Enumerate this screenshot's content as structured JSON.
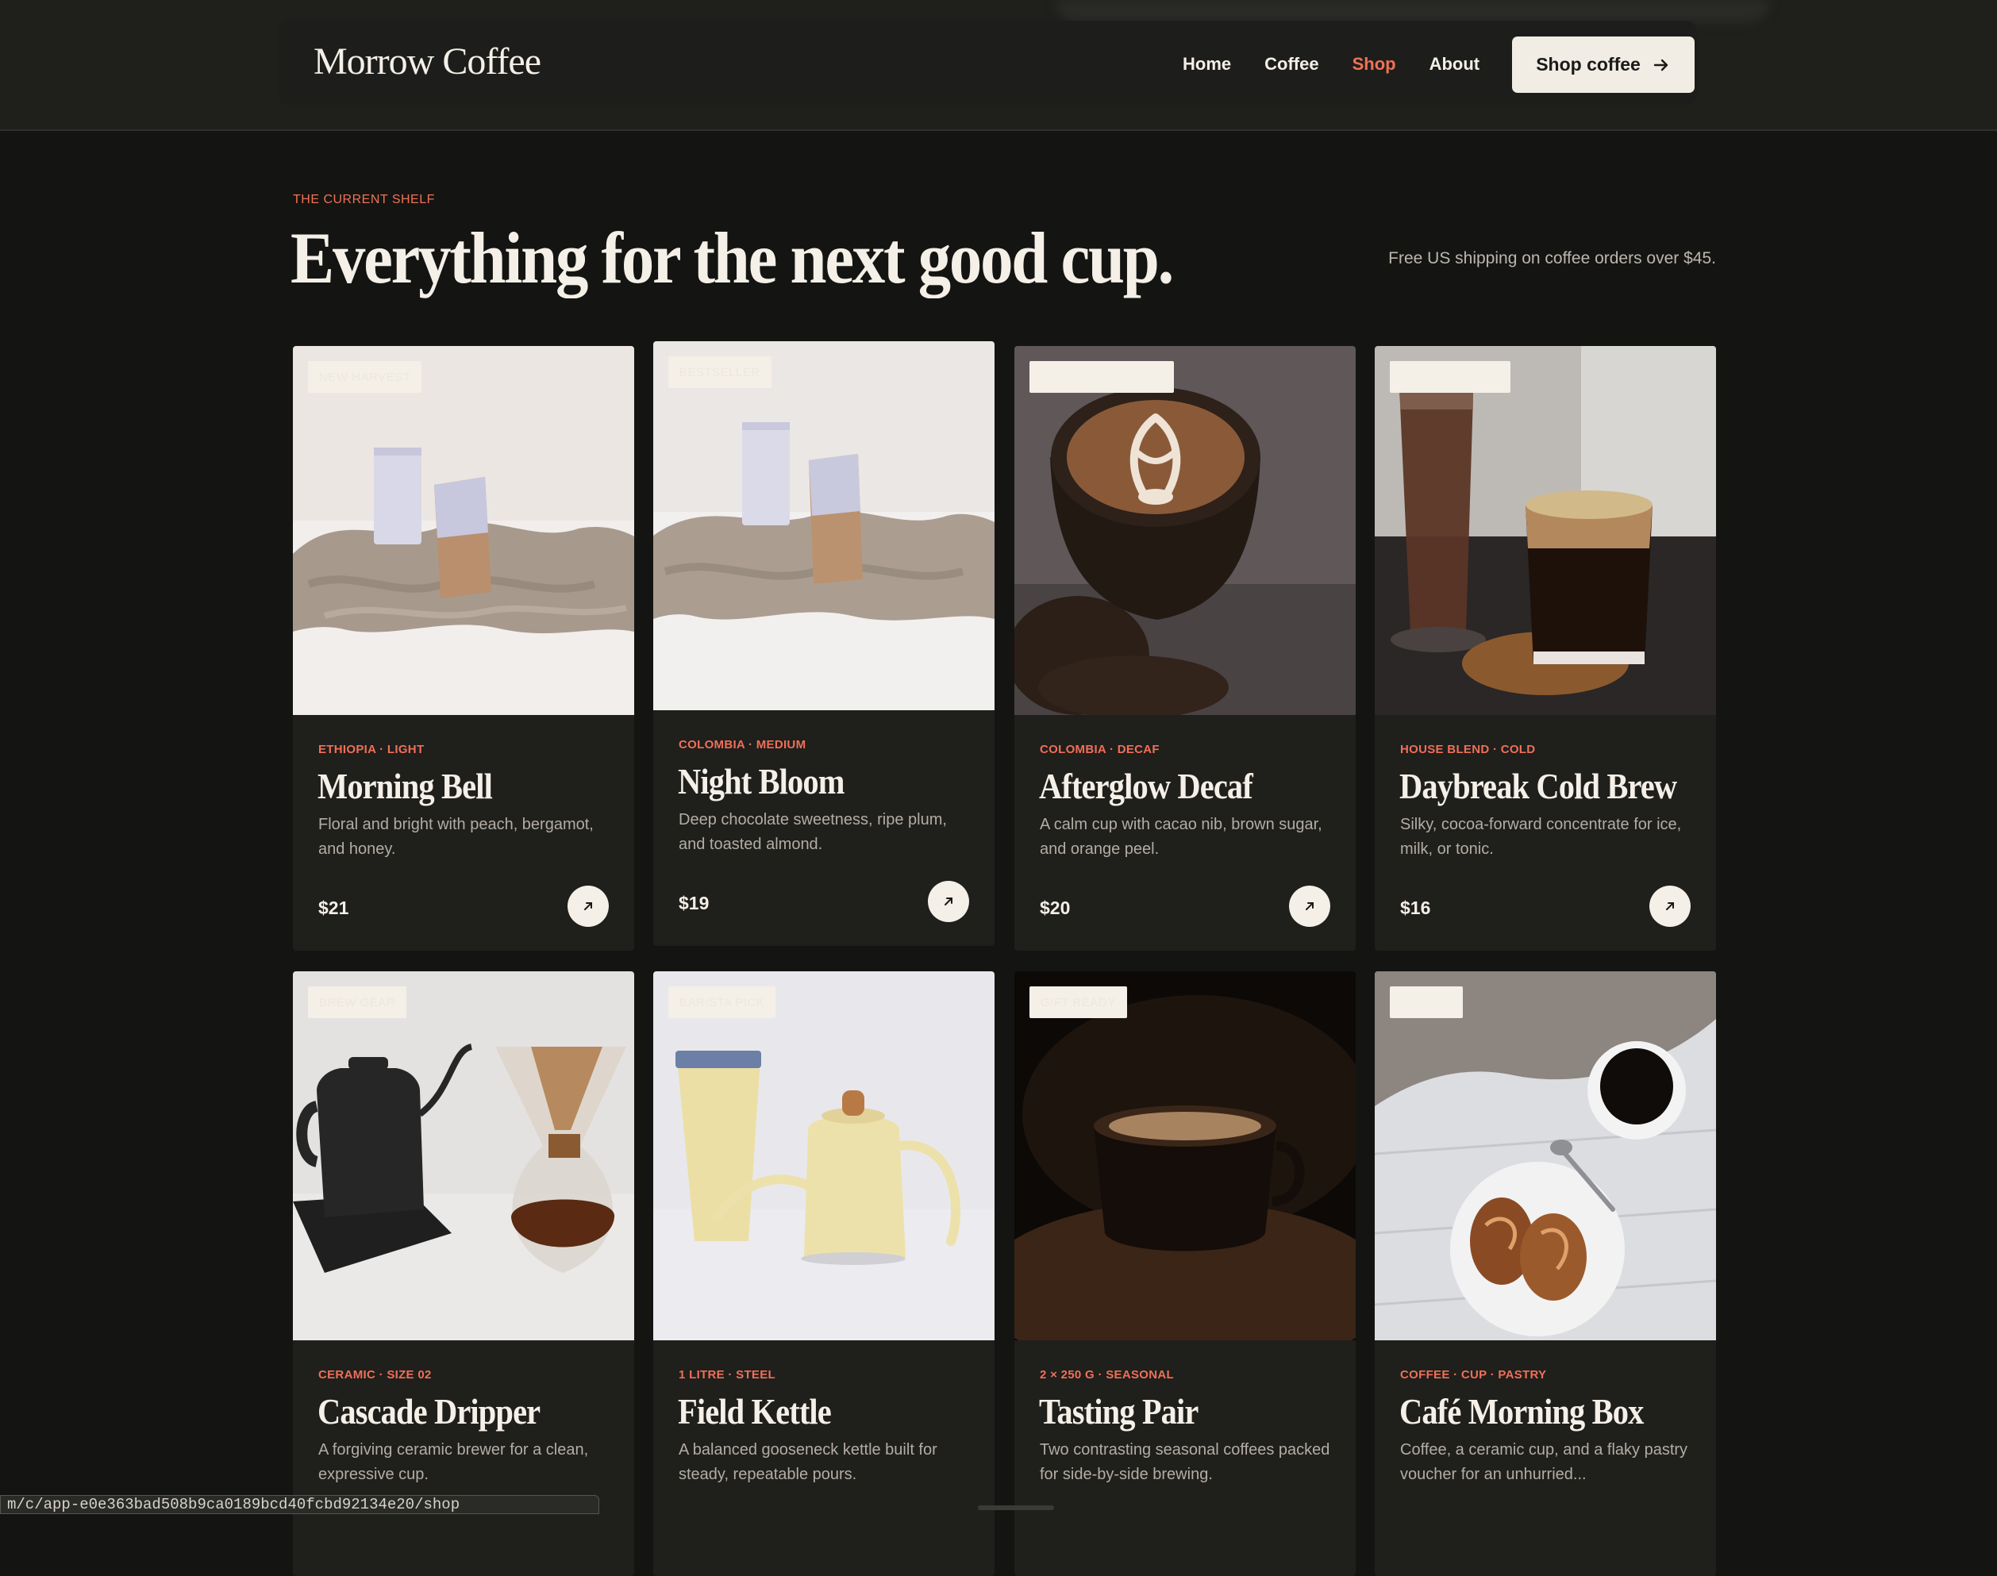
{
  "header": {
    "brand": "Morrow Coffee",
    "nav": [
      {
        "label": "Home",
        "active": false
      },
      {
        "label": "Coffee",
        "active": false
      },
      {
        "label": "Shop",
        "active": true
      },
      {
        "label": "About",
        "active": false
      }
    ],
    "cta_label": "Shop coffee",
    "cta_icon": "arrow-right-icon"
  },
  "hero": {
    "eyebrow": "THE CURRENT SHELF",
    "headline": "Everything for the next good cup.",
    "shipping_note": "Free US shipping on coffee orders over $45."
  },
  "products": [
    {
      "badge": "NEW HARVEST",
      "meta": "ETHIOPIA · LIGHT",
      "name": "Morning Bell",
      "desc": "Floral and bright with peach, bergamot, and honey.",
      "price": "$21",
      "image": "coffee-bags-on-linen"
    },
    {
      "badge": "BESTSELLER",
      "meta": "COLOMBIA · MEDIUM",
      "name": "Night Bloom",
      "desc": "Deep chocolate sweetness, ripe plum, and toasted almond.",
      "price": "$19",
      "image": "coffee-bags-on-linen"
    },
    {
      "badge": "",
      "meta": "COLOMBIA · DECAF",
      "name": "Afterglow Decaf",
      "desc": "A calm cup with cacao nib, brown sugar, and orange peel.",
      "price": "$20",
      "image": "latte-art-glass"
    },
    {
      "badge": "",
      "meta": "HOUSE BLEND · COLD",
      "name": "Daybreak Cold Brew",
      "desc": "Silky, cocoa-forward concentrate for ice, milk, or tonic.",
      "price": "$16",
      "image": "iced-coffee-glasses"
    },
    {
      "badge": "BREW GEAR",
      "meta": "CERAMIC · SIZE 02",
      "name": "Cascade Dripper",
      "desc": "A forgiving ceramic brewer for a clean, expressive cup.",
      "price": "",
      "image": "kettle-and-chemex"
    },
    {
      "badge": "BARISTA PICK",
      "meta": "1 LITRE · STEEL",
      "name": "Field Kettle",
      "desc": "A balanced gooseneck kettle built for steady, repeatable pours.",
      "price": "",
      "image": "cream-kettle-and-tumbler"
    },
    {
      "badge": "GIFT READY",
      "meta": "2 × 250 G · SEASONAL",
      "name": "Tasting Pair",
      "desc": "Two contrasting seasonal coffees packed for side-by-side brewing.",
      "price": "",
      "image": "dark-cup-on-beans"
    },
    {
      "badge": "",
      "meta": "COFFEE · CUP · PASTRY",
      "name": "Café Morning Box",
      "desc": "Coffee, a ceramic cup, and a flaky pastry voucher for an unhurried...",
      "price": "",
      "image": "coffee-and-pastry"
    }
  ],
  "browser": {
    "status_url": "m/c/app-e0e363bad508b9ca0189bcd40fcbd92134e20/shop"
  },
  "colors": {
    "accent": "#f07158",
    "background": "#141512",
    "card": "#1f1f1c",
    "cream": "#f4efe7"
  }
}
